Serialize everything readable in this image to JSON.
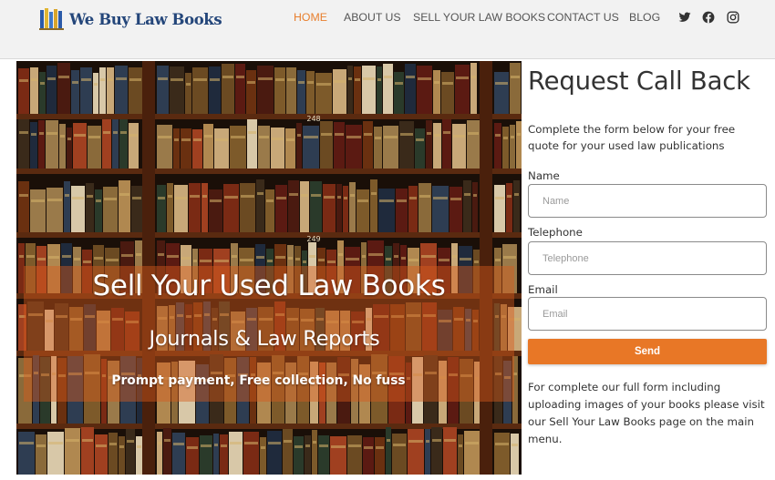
{
  "header": {
    "logo_text": "We Buy Law Books",
    "nav": [
      {
        "label": "HOME",
        "active": true
      },
      {
        "label": "ABOUT US",
        "active": false
      },
      {
        "label": "SELL YOUR LAW BOOKS",
        "active": false
      },
      {
        "label": "CONTACT US",
        "active": false
      },
      {
        "label": "BLOG",
        "active": false
      }
    ],
    "social_icons": [
      "twitter-icon",
      "facebook-icon",
      "instagram-icon"
    ],
    "active_color": "#e8802f"
  },
  "hero": {
    "title": "Sell Your Used Law Books",
    "subtitle": "Journals & Law Reports",
    "tagline": "Prompt payment, Free collection, No fuss",
    "shelf_labels": [
      "248",
      "249"
    ],
    "overlay_color": "#d65c1c"
  },
  "form": {
    "title": "Request Call Back",
    "intro": "Complete the form below for your free quote for your used law publications",
    "fields": [
      {
        "label": "Name",
        "placeholder": "Name"
      },
      {
        "label": "Telephone",
        "placeholder": "Telephone"
      },
      {
        "label": "Email",
        "placeholder": "Email"
      }
    ],
    "submit_label": "Send",
    "submit_color": "#e87726",
    "note": "For complete our full form including uploading images of your books please visit our Sell Your Law Books page on the main menu."
  }
}
